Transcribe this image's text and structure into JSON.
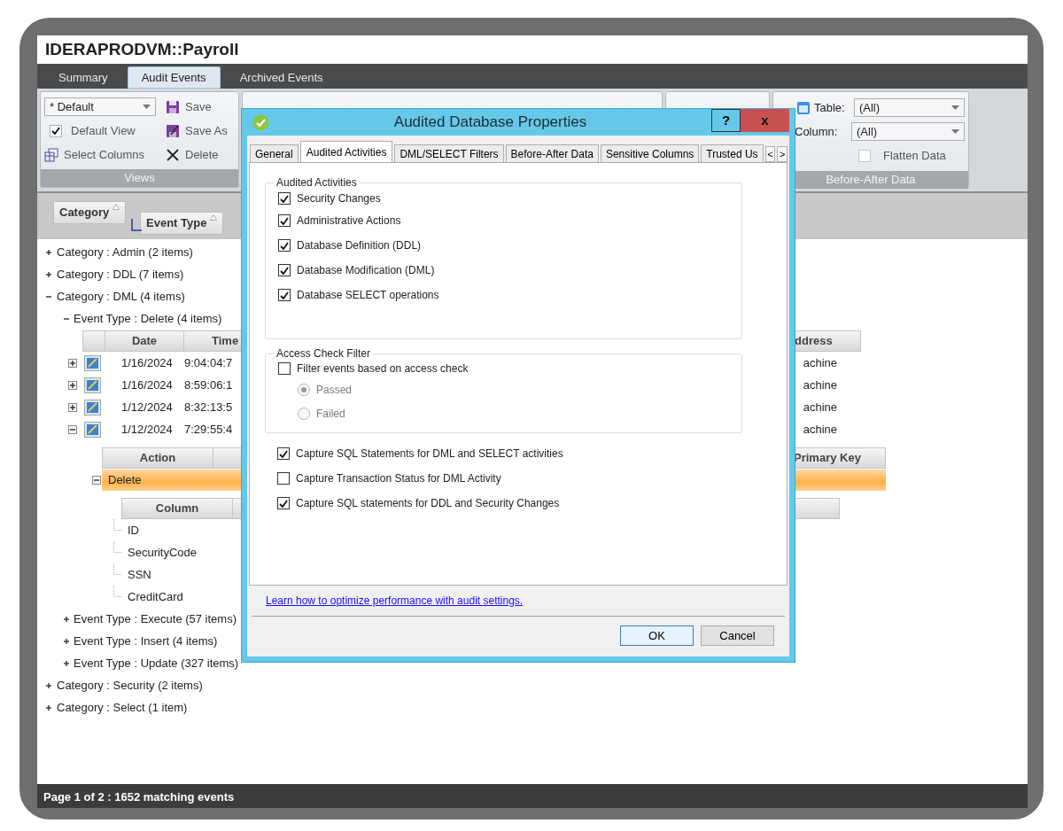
{
  "window": {
    "title": "IDERAPRODVM::Payroll"
  },
  "tabs": [
    {
      "label": "Summary",
      "selected": false
    },
    {
      "label": "Audit Events",
      "selected": true
    },
    {
      "label": "Archived Events",
      "selected": false
    }
  ],
  "ribbon": {
    "views": {
      "view": "* Default",
      "default_view": {
        "label": "Default View",
        "checked": true
      },
      "buttons": [
        {
          "label": "Save",
          "kind": "save"
        },
        {
          "label": "Save As",
          "kind": "saveas"
        },
        {
          "label": "Select Columns",
          "kind": "columns"
        },
        {
          "label": "Delete",
          "kind": "delete"
        }
      ],
      "group_label": "Views"
    },
    "before_after": {
      "table_label": "Table:",
      "table_value": "(All)",
      "column_label": "Column:",
      "column_value": "(All)",
      "flatten": {
        "label": "Flatten Data",
        "checked": false
      },
      "group_label": "Before-After Data"
    }
  },
  "grouping": [
    "Category",
    "Event Type"
  ],
  "tree": [
    {
      "label": "Category : Admin (2 items)",
      "expanded": false
    },
    {
      "label": "Category : DDL (7 items)",
      "expanded": false
    },
    {
      "label": "Category : DML (4 items)",
      "expanded": true,
      "children": [
        {
          "label": "Event Type : Delete (4 items)",
          "expanded": true,
          "events": {
            "columns": [
              "Date",
              "Time"
            ],
            "right_column": "ddress",
            "rows": [
              {
                "date": "1/16/2024",
                "time": "9:04:04:7",
                "address": "achine",
                "expanded": false
              },
              {
                "date": "1/16/2024",
                "time": "8:59:06:1",
                "address": "achine",
                "expanded": false
              },
              {
                "date": "1/12/2024",
                "time": "8:32:13:5",
                "address": "achine",
                "expanded": false
              },
              {
                "date": "1/12/2024",
                "time": "7:29:55:4",
                "address": "achine",
                "expanded": true,
                "details": {
                  "columns": [
                    "Action"
                  ],
                  "right_column": "Primary Key",
                  "rows": [
                    {
                      "action": "Delete",
                      "selected": true,
                      "expanded": true,
                      "columns": {
                        "header": "Column",
                        "items": [
                          "ID",
                          "SecurityCode",
                          "SSN",
                          "CreditCard"
                        ]
                      }
                    }
                  ]
                }
              }
            ]
          }
        },
        {
          "label": "Event Type : Execute (57 items)",
          "expanded": false
        },
        {
          "label": "Event Type : Insert (4 items)",
          "expanded": false
        },
        {
          "label": "Event Type : Update (327 items)",
          "expanded": false
        }
      ]
    },
    {
      "label": "Category : Security (2 items)",
      "expanded": false
    },
    {
      "label": "Category : Select (1 item)",
      "expanded": false
    }
  ],
  "status_bar": "Page 1 of 2 : 1652 matching events",
  "dialog": {
    "title": "Audited Database Properties",
    "help": "?",
    "close": "x",
    "tabs": [
      {
        "label": "General",
        "selected": false
      },
      {
        "label": "Audited Activities",
        "selected": true
      },
      {
        "label": "DML/SELECT Filters",
        "selected": false
      },
      {
        "label": "Before-After Data",
        "selected": false
      },
      {
        "label": "Sensitive Columns",
        "selected": false
      },
      {
        "label": "Trusted Us",
        "selected": false
      }
    ],
    "tab_scroll": [
      "<",
      ">"
    ],
    "audited_activities": {
      "legend": "Audited Activities",
      "options": [
        {
          "label": "Security Changes",
          "checked": true
        },
        {
          "label": "Administrative Actions",
          "checked": true
        },
        {
          "label": "Database Definition (DDL)",
          "checked": true
        },
        {
          "label": "Database Modification (DML)",
          "checked": true
        },
        {
          "label": "Database SELECT operations",
          "checked": true
        }
      ]
    },
    "access_check": {
      "legend": "Access Check Filter",
      "filter": {
        "label": "Filter events based on access check",
        "checked": false
      },
      "results": [
        {
          "label": "Passed",
          "selected": true,
          "disabled": true
        },
        {
          "label": "Failed",
          "selected": false,
          "disabled": true
        }
      ]
    },
    "capture": [
      {
        "label": "Capture SQL Statements for DML and SELECT activities",
        "checked": true
      },
      {
        "label": "Capture Transaction Status for DML Activity",
        "checked": false
      },
      {
        "label": "Capture SQL statements for DDL and Security Changes",
        "checked": true
      }
    ],
    "link": "Learn how to optimize performance with audit settings.",
    "buttons": [
      "OK",
      "Cancel"
    ]
  }
}
